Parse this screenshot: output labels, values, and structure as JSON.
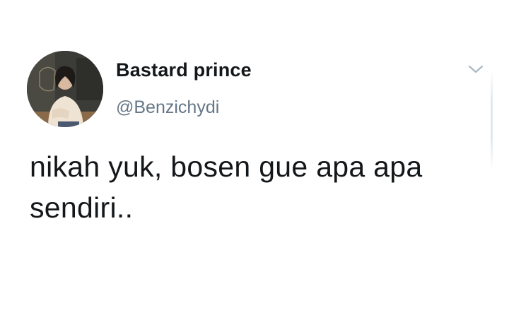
{
  "tweet": {
    "author": {
      "display_name": "Bastard prince",
      "handle": "@Benzichydi",
      "avatar_icon": "profile-photo"
    },
    "caret_icon": "chevron-down-icon",
    "text": "nikah yuk, bosen gue apa apa sendiri..",
    "colors": {
      "text": "#14171a",
      "secondary": "#657786",
      "caret": "#aab8c2",
      "background": "#ffffff"
    }
  }
}
